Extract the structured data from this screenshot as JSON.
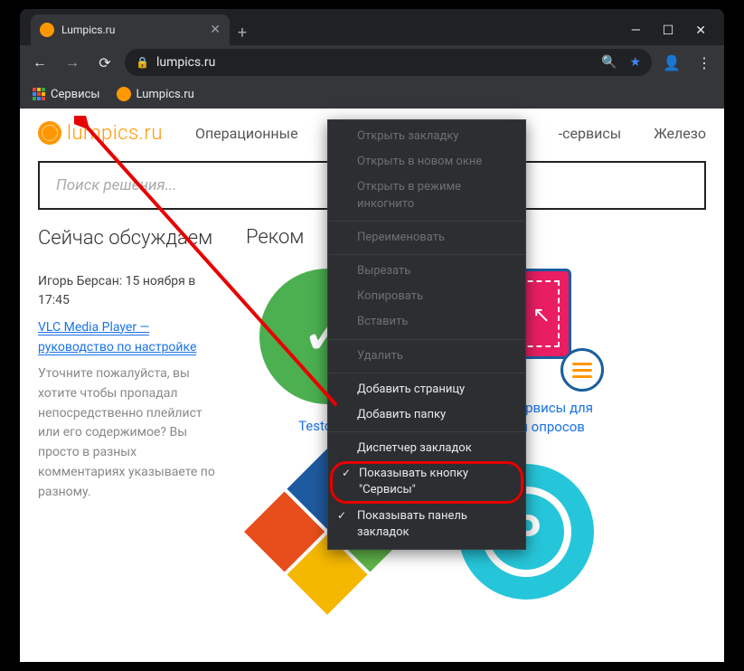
{
  "tab": {
    "title": "Lumpics.ru"
  },
  "omnibox": {
    "url": "lumpics.ru"
  },
  "bookmarks": {
    "apps": "Сервисы",
    "item1": "Lumpics.ru"
  },
  "logo": "lumpics.ru",
  "nav": {
    "os": "Операционные",
    "services": "-сервисы",
    "hw": "Железо"
  },
  "search": {
    "placeholder": "Поиск решения..."
  },
  "left": {
    "title": "Сейчас обсуждаем",
    "meta1": "Игорь Берсан: 15 ноября в 17:45",
    "link": "VLC Media Player — руководство по настройке",
    "desc": "Уточните пожалуйста, вы хотите чтобы пропадал непосредственно плейлист или его содержимое? Вы просто в разных комментариях указываете по разному."
  },
  "right": {
    "title": "Реком"
  },
  "cards": {
    "c1": "Testograf",
    "c2": "Онлайн-сервисы для создания опросов"
  },
  "ctx": {
    "open": "Открыть закладку",
    "openwin": "Открыть в новом окне",
    "incog": "Открыть в режиме инкогнито",
    "rename": "Переименовать",
    "cut": "Вырезать",
    "copy": "Копировать",
    "paste": "Вставить",
    "delete": "Удалить",
    "addpage": "Добавить страницу",
    "addfolder": "Добавить папку",
    "manager": "Диспетчер закладок",
    "showapps": "Показывать кнопку \"Сервисы\"",
    "showbar": "Показывать панель закладок"
  }
}
